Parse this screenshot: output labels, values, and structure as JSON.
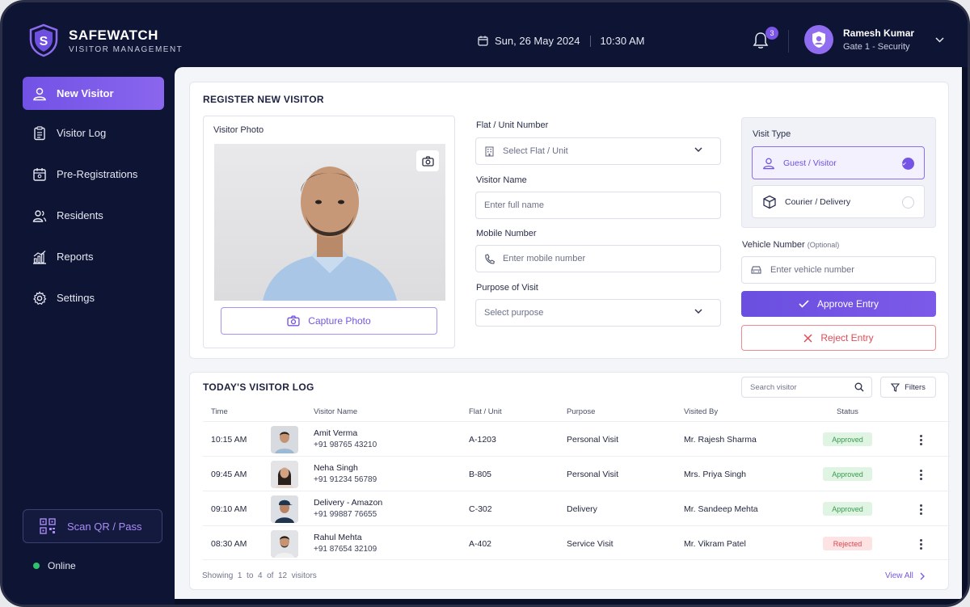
{
  "brand": {
    "name": "SAFEWATCH",
    "subtitle": "VISITOR MANAGEMENT"
  },
  "header": {
    "date": "Sun, 26 May 2024",
    "time": "10:30 AM",
    "notifications": "3",
    "user_name": "Ramesh Kumar",
    "user_role": "Gate 1 - Security"
  },
  "sidebar": {
    "items": [
      {
        "label": "New Visitor",
        "icon": "user-icon",
        "active": true
      },
      {
        "label": "Visitor Log",
        "icon": "clipboard-icon",
        "active": false
      },
      {
        "label": "Pre-Registrations",
        "icon": "calendar-icon",
        "active": false
      },
      {
        "label": "Residents",
        "icon": "users-icon",
        "active": false
      },
      {
        "label": "Reports",
        "icon": "chart-icon",
        "active": false
      },
      {
        "label": "Settings",
        "icon": "gear-icon",
        "active": false
      }
    ],
    "scan_label": "Scan QR / Pass",
    "status": "Online"
  },
  "register": {
    "title": "REGISTER NEW VISITOR",
    "photo_label": "Visitor Photo",
    "capture_label": "Capture Photo",
    "flat_label": "Flat / Unit Number",
    "flat_placeholder": "Select Flat / Unit",
    "name_label": "Visitor Name",
    "name_placeholder": "Enter full name",
    "mobile_label": "Mobile Number",
    "mobile_placeholder": "Enter mobile number",
    "purpose_label": "Purpose of Visit",
    "purpose_placeholder": "Select purpose",
    "visit_type_label": "Visit Type",
    "visit_types": [
      {
        "label": "Guest / Visitor",
        "selected": true
      },
      {
        "label": "Courier / Delivery",
        "selected": false
      }
    ],
    "vehicle_label": "Vehicle Number",
    "vehicle_optional": "(Optional)",
    "vehicle_placeholder": "Enter vehicle number",
    "approve_label": "Approve Entry",
    "reject_label": "Reject Entry"
  },
  "log": {
    "title": "TODAY'S VISITOR LOG",
    "search_placeholder": "Search visitor",
    "filters_label": "Filters",
    "columns": [
      "Time",
      "Visitor Name",
      "Flat / Unit",
      "Purpose",
      "Visited By",
      "Status"
    ],
    "rows": [
      {
        "time": "10:15 AM",
        "name": "Amit Verma",
        "phone": "+91 98765 43210",
        "flat": "A-1203",
        "purpose": "Personal Visit",
        "visited_by": "Mr. Rajesh Sharma",
        "status": "Approved"
      },
      {
        "time": "09:45 AM",
        "name": "Neha Singh",
        "phone": "+91 91234 56789",
        "flat": "B-805",
        "purpose": "Personal Visit",
        "visited_by": "Mrs. Priya Singh",
        "status": "Approved"
      },
      {
        "time": "09:10 AM",
        "name": "Delivery - Amazon",
        "phone": "+91 99887 76655",
        "flat": "C-302",
        "purpose": "Delivery",
        "visited_by": "Mr. Sandeep Mehta",
        "status": "Approved"
      },
      {
        "time": "08:30 AM",
        "name": "Rahul Mehta",
        "phone": "+91 87654 32109",
        "flat": "A-402",
        "purpose": "Service Visit",
        "visited_by": "Mr. Vikram Patel",
        "status": "Rejected"
      }
    ],
    "footer": {
      "prefix": "Showing",
      "from": "1",
      "to_word": "to",
      "to": "4",
      "of_word": "of",
      "total": "12",
      "suffix": "visitors"
    },
    "view_all": "View All"
  },
  "colors": {
    "accent": "#7455e6",
    "sidebar": "#0e1433",
    "approved": "#3a9a4d",
    "rejected": "#d9474f"
  }
}
